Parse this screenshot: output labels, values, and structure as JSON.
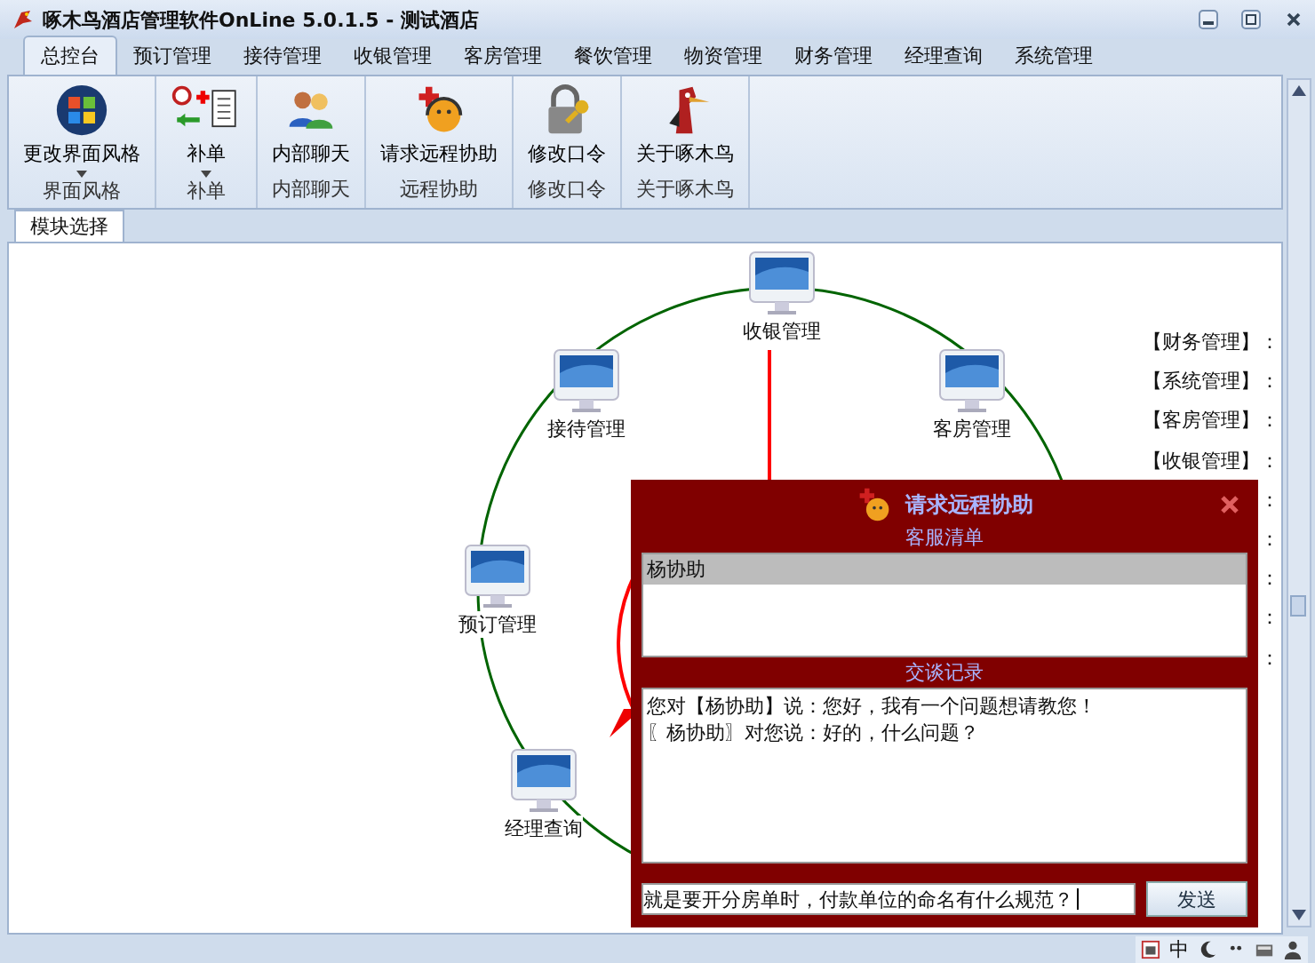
{
  "window": {
    "title": "啄木鸟酒店管理软件OnLine 5.0.1.5 - 测试酒店"
  },
  "tabs": [
    {
      "label": "总控台",
      "selected": true
    },
    {
      "label": "预订管理",
      "selected": false
    },
    {
      "label": "接待管理",
      "selected": false
    },
    {
      "label": "收银管理",
      "selected": false
    },
    {
      "label": "客房管理",
      "selected": false
    },
    {
      "label": "餐饮管理",
      "selected": false
    },
    {
      "label": "物资管理",
      "selected": false
    },
    {
      "label": "财务管理",
      "selected": false
    },
    {
      "label": "经理查询",
      "selected": false
    },
    {
      "label": "系统管理",
      "selected": false
    }
  ],
  "ribbon_groups": [
    {
      "button": "更改界面风格",
      "dropdown": true,
      "label": "界面风格"
    },
    {
      "button": "补单",
      "dropdown": true,
      "label": "补单"
    },
    {
      "button": "内部聊天",
      "dropdown": false,
      "label": "内部聊天"
    },
    {
      "button": "请求远程协助",
      "dropdown": false,
      "label": "远程协助"
    },
    {
      "button": "修改口令",
      "dropdown": false,
      "label": "修改口令"
    },
    {
      "button": "关于啄木鸟",
      "dropdown": false,
      "label": "关于啄木鸟"
    }
  ],
  "content_tab": {
    "label": "模块选择",
    "selected": true
  },
  "diagram_nodes": [
    {
      "label": "收银管理"
    },
    {
      "label": "接待管理"
    },
    {
      "label": "客房管理"
    },
    {
      "label": "预订管理"
    },
    {
      "label": "经理查询"
    }
  ],
  "side_labels": [
    "【财务管理】：",
    "【系统管理】：",
    "【客房管理】：",
    "【收银管理】：",
    "：",
    "：",
    "：",
    "：",
    "："
  ],
  "dialog": {
    "title": "请求远程协助",
    "list_heading": "客服清单",
    "agents": [
      {
        "name": "杨协助",
        "selected": true
      }
    ],
    "chat_heading": "交谈记录",
    "messages": [
      "您对【杨协助】说：您好，我有一个问题想请教您！",
      "〖杨协助〗对您说：好的，什么问题？"
    ],
    "input": "就是要开分房单时，付款单位的命名有什么规范？",
    "send": "发送"
  },
  "tray": {
    "ime": "中"
  }
}
